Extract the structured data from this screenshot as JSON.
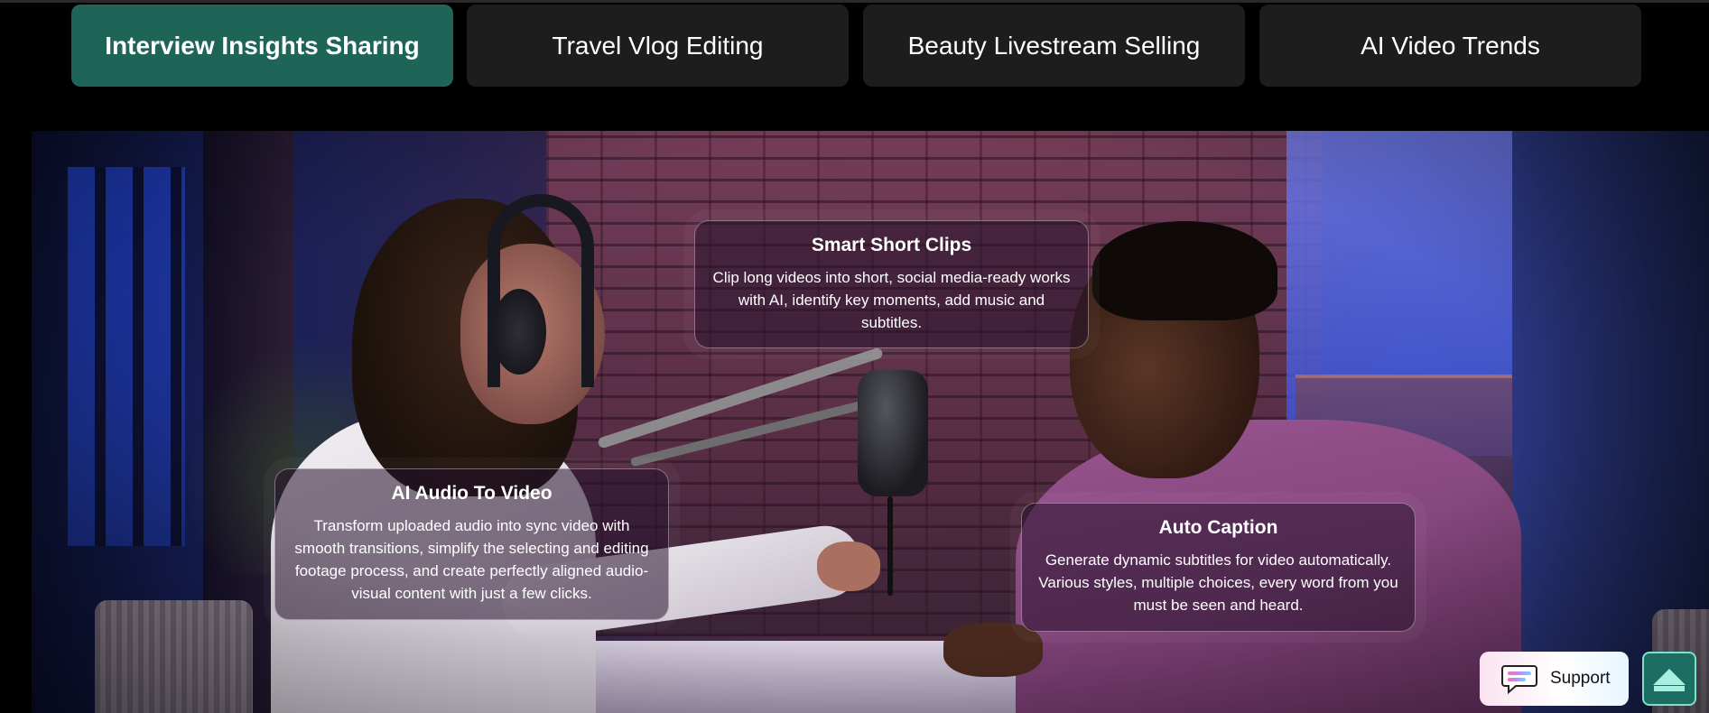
{
  "tabs": [
    {
      "label": "Interview Insights Sharing",
      "active": true
    },
    {
      "label": "Travel Vlog Editing",
      "active": false
    },
    {
      "label": "Beauty Livestream Selling",
      "active": false
    },
    {
      "label": "AI Video Trends",
      "active": false
    }
  ],
  "features": {
    "smart_clips": {
      "title": "Smart Short Clips",
      "description": "Clip long videos into short, social media-ready works with AI, identify key moments, add music and subtitles."
    },
    "audio_to_video": {
      "title": "AI Audio To Video",
      "description": "Transform uploaded audio into sync video with smooth transitions, simplify the selecting and editing footage process, and create perfectly aligned audio-visual content with just a few clicks."
    },
    "auto_caption": {
      "title": "Auto Caption",
      "description": "Generate dynamic subtitles for video automatically. Various styles, multiple choices, every word from you must be seen and heard."
    }
  },
  "support": {
    "label": "Support",
    "icon": "chat-bubble-icon"
  },
  "scroll_top": {
    "icon": "arrow-up-to-top-icon"
  },
  "colors": {
    "active_tab": "#1e6457",
    "inactive_tab": "#1d1d1d",
    "scroll_top_bg": "#1d6e62"
  }
}
